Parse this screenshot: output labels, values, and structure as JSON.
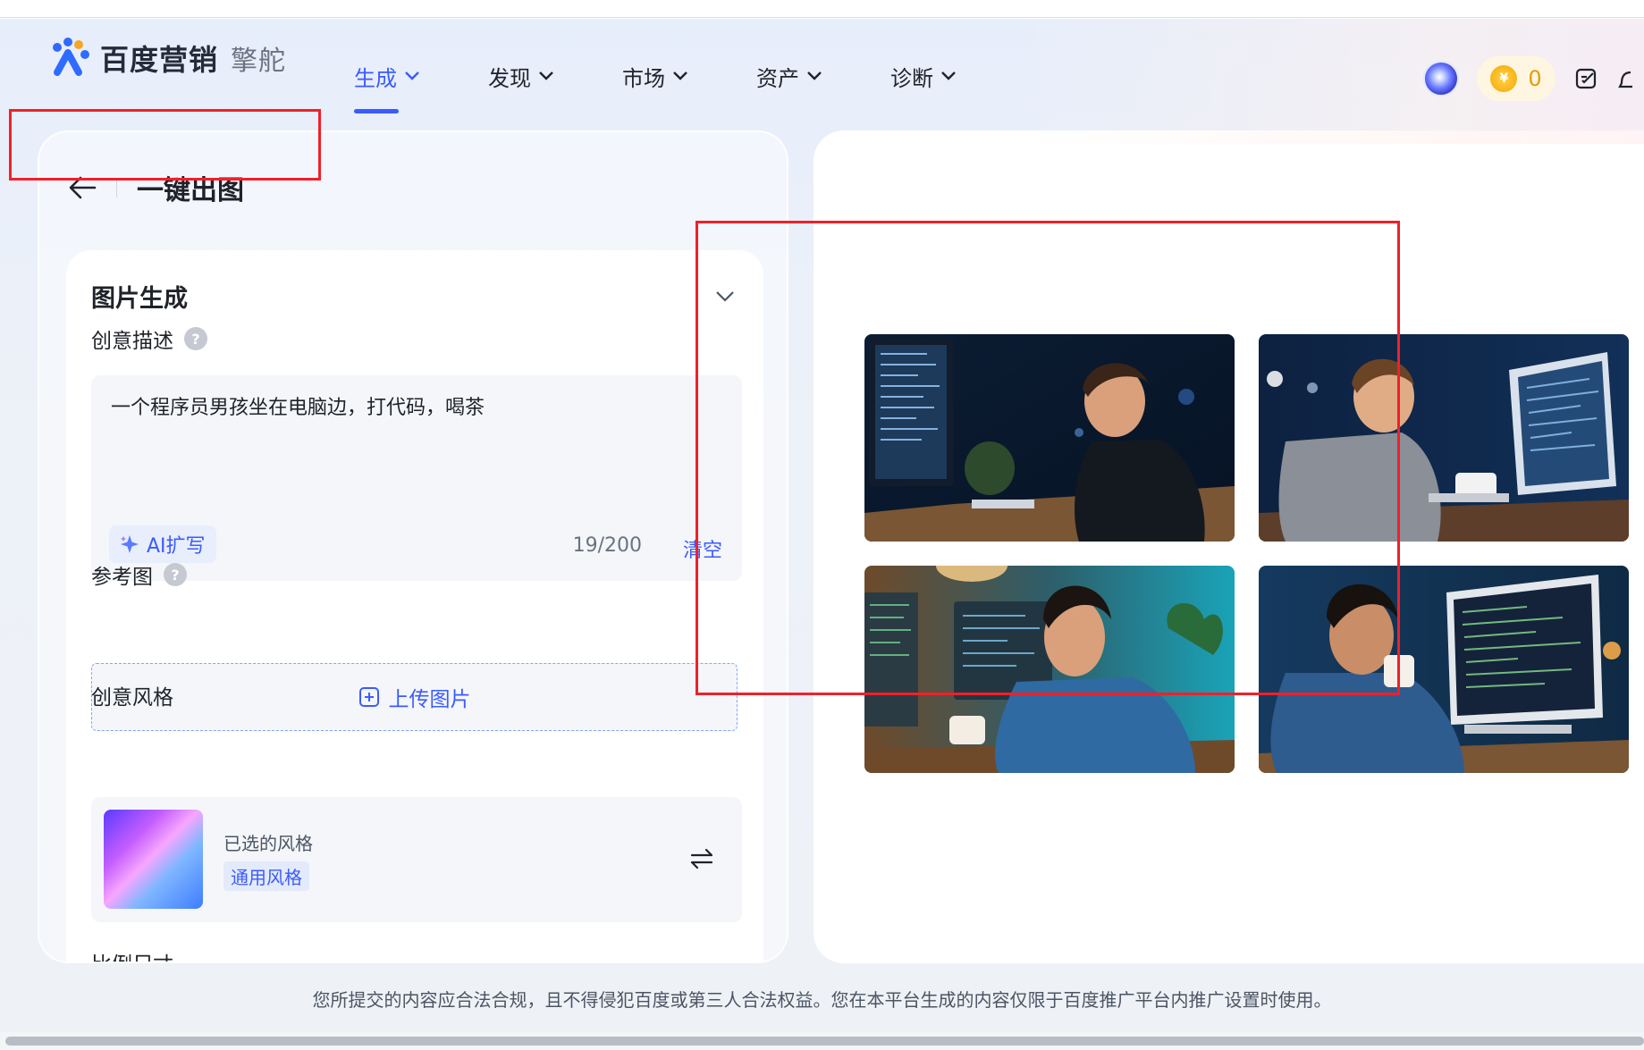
{
  "brand": {
    "name": "百度营销",
    "product": "擎舵"
  },
  "nav": {
    "items": [
      {
        "label": "生成",
        "active": true
      },
      {
        "label": "发现",
        "active": false
      },
      {
        "label": "市场",
        "active": false
      },
      {
        "label": "资产",
        "active": false
      },
      {
        "label": "诊断",
        "active": false
      }
    ]
  },
  "header_right": {
    "coin_count": "0",
    "icons": [
      "avatar",
      "coin-icon",
      "edit-icon"
    ]
  },
  "page": {
    "title": "一键出图",
    "back_icon": "arrow-left-icon"
  },
  "form": {
    "section_title": "图片生成",
    "prompt": {
      "label": "创意描述",
      "value": "一个程序员男孩坐在电脑边，打代码，喝茶",
      "ai_button": "AI扩写",
      "char_count": "19/200",
      "clear_label": "清空"
    },
    "reference": {
      "label": "参考图",
      "upload_label": "上传图片"
    },
    "style": {
      "label": "创意风格",
      "caption": "已选的风格",
      "selected": "通用风格"
    }
  },
  "results": {
    "images": [
      {
        "alt": "generated-image-1"
      },
      {
        "alt": "generated-image-2"
      },
      {
        "alt": "generated-image-3"
      },
      {
        "alt": "generated-image-4"
      }
    ]
  },
  "footer": {
    "note": "您所提交的内容应合法合规，且不得侵犯百度或第三人合法权益。您在本平台生成的内容仅限于百度推广平台内推广设置时使用。"
  },
  "colors": {
    "accent": "#3b5bff",
    "highlight_box": "#f0202a",
    "coin": "#e89a00"
  }
}
